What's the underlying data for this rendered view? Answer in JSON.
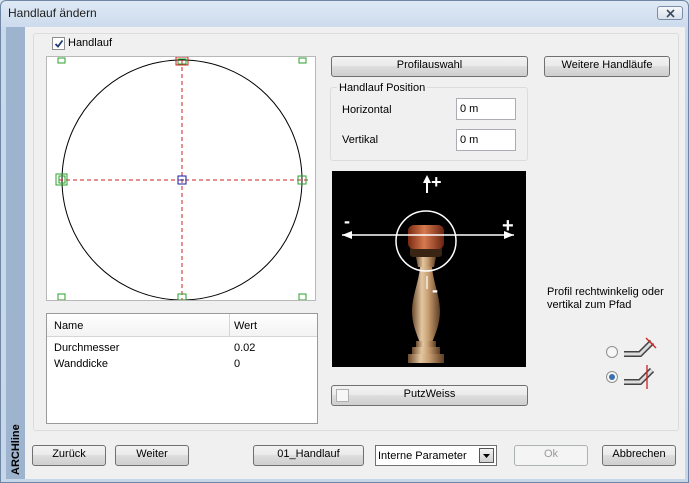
{
  "window": {
    "title": "Handlauf ändern"
  },
  "sidebar": {
    "brand": "ARCHline"
  },
  "handlauf": {
    "checkbox_label": "Handlauf",
    "checked": true
  },
  "buttons": {
    "profilauswahl": "Profilauswahl",
    "weitere": "Weitere Handläufe",
    "putzweiss": "PutzWeiss",
    "zurueck": "Zurück",
    "weiter": "Weiter",
    "profile_name": "01_Handlauf",
    "ok": "Ok",
    "abbrechen": "Abbrechen"
  },
  "position": {
    "legend": "Handlauf Position",
    "horizontal_label": "Horizontal",
    "horizontal_value": "0 m",
    "vertikal_label": "Vertikal",
    "vertikal_value": "0 m"
  },
  "table": {
    "headers": [
      "Name",
      "Wert"
    ],
    "rows": [
      {
        "name": "Durchmesser",
        "value": "0.02"
      },
      {
        "name": "Wanddicke",
        "value": "0"
      }
    ]
  },
  "preview": {
    "plus_top": "+",
    "minus_left": "-",
    "plus_right": "+",
    "minus_bottom": "-"
  },
  "orientation": {
    "text_line1": "Profil rechtwinkelig oder",
    "text_line2": "vertikal zum Pfad",
    "selected": "vertical"
  },
  "parameters": {
    "selected": "Interne Parameter"
  },
  "colors": {
    "sidebar": "#9eb3cd",
    "handle_green": "#2aa02a",
    "handle_red": "#d02020",
    "center_blue": "#1a1aa0"
  }
}
